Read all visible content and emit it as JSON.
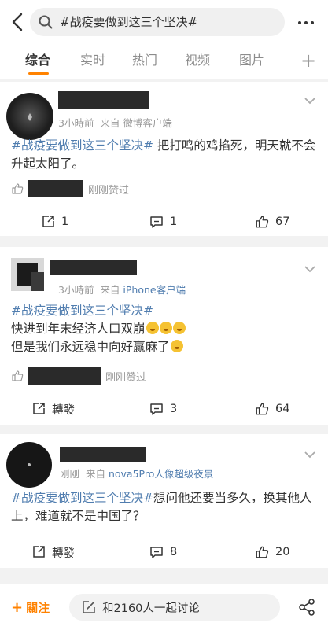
{
  "search": {
    "query": "#战疫要做到这三个坚决#"
  },
  "tabs": [
    "综合",
    "实时",
    "热门",
    "视频",
    "图片"
  ],
  "tab_add": "+",
  "posts": [
    {
      "time": "3小時前",
      "source_prefix": "来自",
      "source": "微博客户端",
      "topic": "#战疫要做到这三个坚决#",
      "text": " 把打鸣的鸡掐死，明天就不会升起太阳了。",
      "like_note": "刚刚赞过",
      "actions": {
        "repost": "1",
        "comment": "1",
        "like": "67"
      }
    },
    {
      "time": "3小時前",
      "source_prefix": "来自",
      "source": "iPhone客户端",
      "topic": "#战疫要做到这三个坚决#",
      "line1": "快进到年末经济人口双崩",
      "line2": "但是我们永远稳中向好赢麻了",
      "like_note": "刚刚赞过",
      "actions": {
        "repost": "轉發",
        "comment": "3",
        "like": "64"
      }
    },
    {
      "time": "刚刚",
      "source_prefix": "来自",
      "source": "nova5Pro人像超级夜景",
      "topic": "#战疫要做到这三个坚决#",
      "text": "想问他还要当多久，换其他人上，难道就不是中国了？",
      "actions": {
        "repost": "轉發",
        "comment": "8",
        "like": "20"
      }
    }
  ],
  "bottom": {
    "follow": "關注",
    "discuss": "和2160人一起讨论"
  },
  "colors": {
    "accent": "#ff8200",
    "link": "#507daf"
  }
}
